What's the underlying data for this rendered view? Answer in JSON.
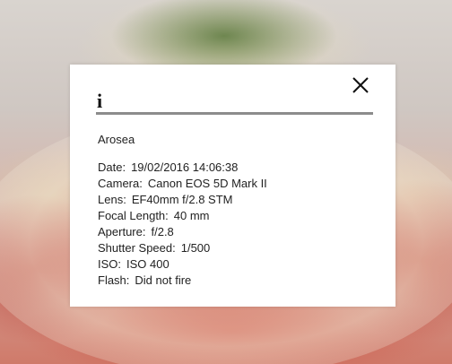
{
  "photo": {
    "title": "Arosea"
  },
  "dialog": {
    "info_glyph": "i",
    "close_icon": "close-icon"
  },
  "metadata": [
    {
      "label": "Date:",
      "value": "19/02/2016 14:06:38"
    },
    {
      "label": "Camera:",
      "value": "Canon EOS 5D Mark II"
    },
    {
      "label": "Lens:",
      "value": "EF40mm f/2.8 STM"
    },
    {
      "label": "Focal Length:",
      "value": "40 mm"
    },
    {
      "label": "Aperture:",
      "value": "f/2.8"
    },
    {
      "label": "Shutter Speed:",
      "value": "1/500"
    },
    {
      "label": "ISO:",
      "value": "ISO 400"
    },
    {
      "label": "Flash:",
      "value": "Did not fire"
    }
  ],
  "colors": {
    "dialog_background": "#ffffff",
    "divider": "#8c8c8c",
    "text": "#222222"
  }
}
